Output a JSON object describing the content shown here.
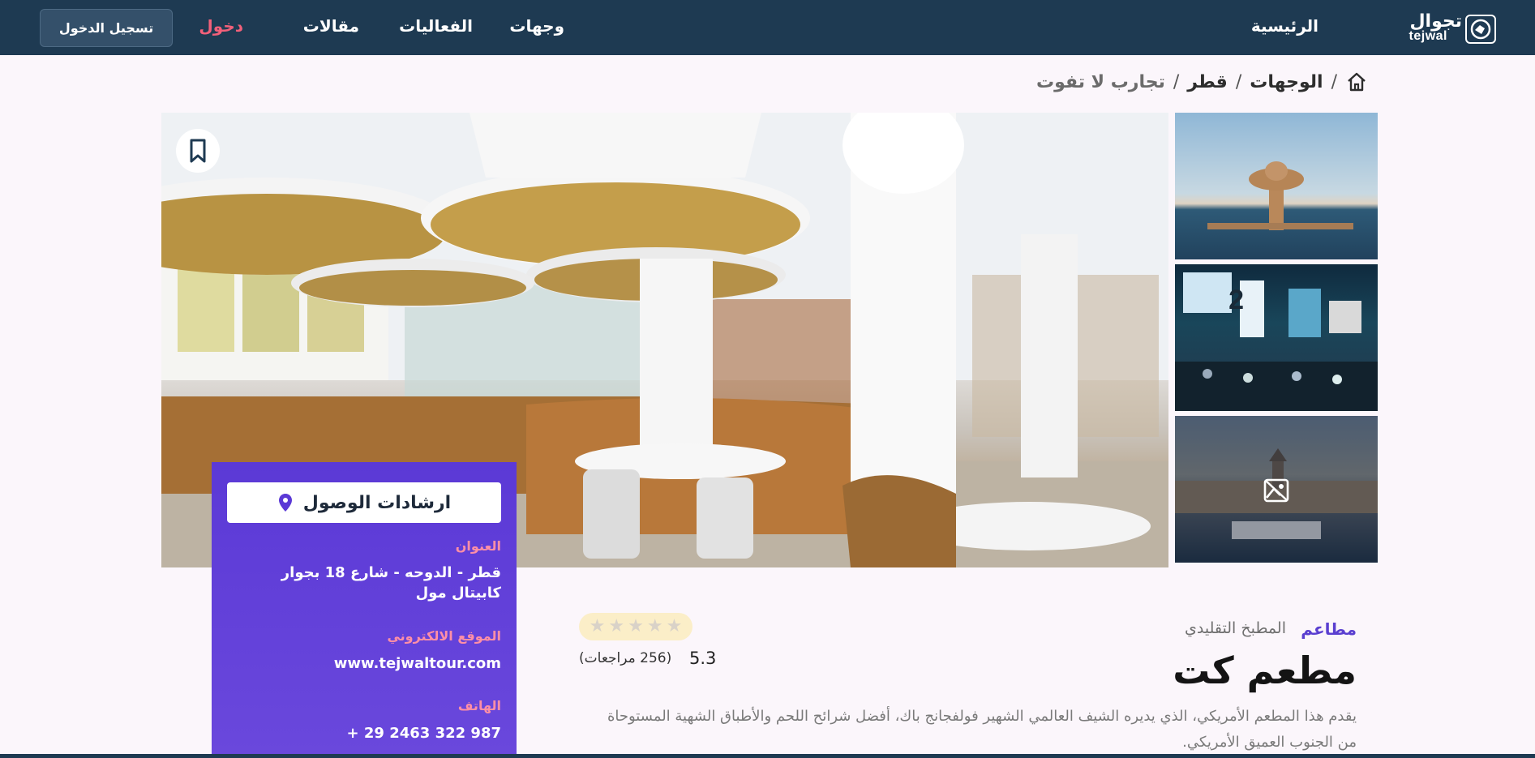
{
  "header": {
    "logo_ar": "تجوال",
    "logo_en": "tejwal",
    "nav": [
      {
        "label": "الرئيسية"
      },
      {
        "label": "وجهات"
      },
      {
        "label": "الفعاليات"
      },
      {
        "label": "مقالات"
      }
    ],
    "login_label": "دخول",
    "signup_label": "تسجيل الدخول"
  },
  "breadcrumb": {
    "items": [
      "الوجهات",
      "قطر"
    ],
    "current": "تجارب لا تفوت"
  },
  "gallery": {
    "main_photo": "restaurant-interior",
    "thumbnails": [
      "tower-by-sea",
      "city-night-street",
      "istanbul-skyline"
    ]
  },
  "info_card": {
    "directions_label": "ارشادات الوصول",
    "address_label": "العنوان",
    "address_value": "قطر - الدوحه - شارع 18 بجوار كابيتال مول",
    "website_label": "الموقع الالكتروني",
    "website_value": "www.tejwaltour.com",
    "phone_label": "الهاتف",
    "phone_value": "+ 29 2463 322 987"
  },
  "details": {
    "category": "مطاعم",
    "subcategory": "المطبخ التقليدي",
    "title": "مطعم كت",
    "description": "يقدم هذا المطعم الأمريكي، الذي يديره الشيف العالمي الشهير فولفجانج باك، أفضل شرائح اللحم والأطباق الشهية المستوحاة من الجنوب العميق الأمريكي.",
    "rating_value": "5.3",
    "reviews_text": "(256 مراجعات)",
    "stars_total": 5
  },
  "colors": {
    "header_bg": "#1e3a52",
    "accent_purple": "#5b39d6",
    "login_pink": "#f2607a"
  }
}
